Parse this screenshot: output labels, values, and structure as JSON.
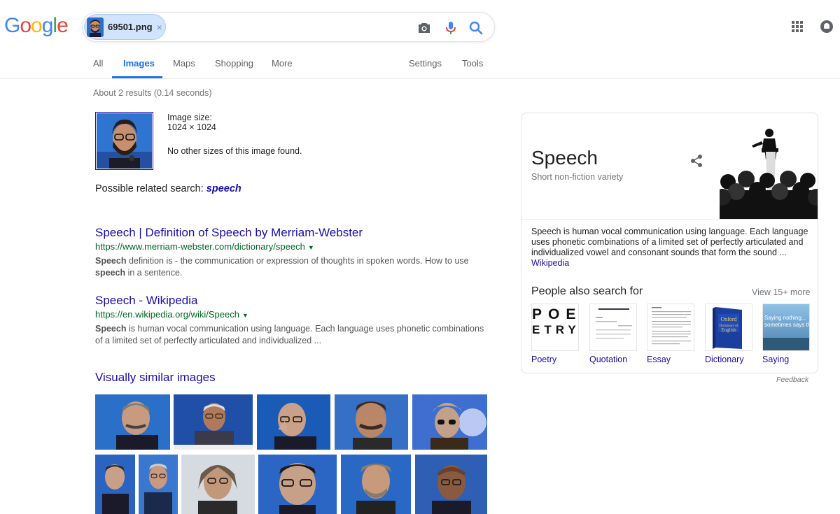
{
  "header": {
    "logo_letters": [
      "G",
      "o",
      "o",
      "g",
      "l",
      "e"
    ],
    "logo_colors": [
      "#4285f4",
      "#ea4335",
      "#fbbc05",
      "#4285f4",
      "#34a853",
      "#ea4335"
    ],
    "chip_filename": "69501.png",
    "chip_close": "×"
  },
  "tabs": [
    {
      "label": "All"
    },
    {
      "label": "Images",
      "active": true
    },
    {
      "label": "Maps"
    },
    {
      "label": "Shopping"
    },
    {
      "label": "More"
    },
    {
      "label": "Settings"
    },
    {
      "label": "Tools"
    }
  ],
  "stats": "About 2 results (0.14 seconds)",
  "query_image": {
    "size_label": "Image size:",
    "size_value": "1024 × 1024",
    "no_other_sizes": "No other sizes of this image found.",
    "related_prefix": "Possible related search:",
    "related_term": "speech"
  },
  "results": [
    {
      "title": "Speech | Definition of Speech by Merriam-Webster",
      "url": "https://www.merriam-webster.com/dictionary/speech",
      "snippet_bold1": "Speech",
      "snippet_text1": " definition is - the communication or expression of thoughts in spoken words. How to use ",
      "snippet_bold2": "speech",
      "snippet_text2": " in a sentence."
    },
    {
      "title": "Speech - Wikipedia",
      "url": "https://en.wikipedia.org/wiki/Speech",
      "snippet_bold1": "Speech",
      "snippet_text1": " is human vocal communication using language. Each language uses phonetic combinations of a limited set of perfectly articulated and individualized ..."
    }
  ],
  "visually_similar_title": "Visually similar images",
  "knowledge_panel": {
    "title": "Speech",
    "subtitle": "Short non-fiction variety",
    "description": "Speech is human vocal communication using language. Each language uses phonetic combinations of a limited set of perfectly articulated and individualized vowel and consonant sounds that form the sound ...",
    "wiki_link": "Wikipedia",
    "people_also_search": "People also search for",
    "view_more": "View 15+ more",
    "items": [
      {
        "label": "Poetry"
      },
      {
        "label": "Quotation"
      },
      {
        "label": "Essay"
      },
      {
        "label": "Dictionary"
      },
      {
        "label": "Saying"
      }
    ],
    "poetry_lines": [
      "POE",
      "ETRY"
    ],
    "dictionary_cover": "Oxford Dictionary of English",
    "saying_text": "Saying nothing... sometimes says the m"
  },
  "feedback": "Feedback",
  "colors": {
    "link": "#1a0dab",
    "url_green": "#006621",
    "tab_active": "#1a73e8",
    "chip_bg": "#d2e3fc"
  }
}
